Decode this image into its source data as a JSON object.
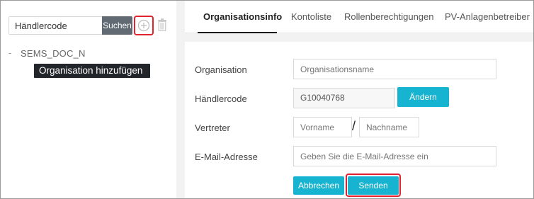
{
  "search": {
    "placeholder": "Händlercode",
    "button_label": "Suchen"
  },
  "icons": {
    "add": "plus-circle-icon",
    "delete": "trash-icon"
  },
  "tree": {
    "root_dash": "-",
    "root_label": "SEMS_DOC_N",
    "tooltip": "Organisation hinzufügen"
  },
  "tabs": [
    {
      "label": "Organisationsinfo",
      "active": true
    },
    {
      "label": "Kontoliste",
      "active": false
    },
    {
      "label": "Rollenberechtigungen",
      "active": false
    },
    {
      "label": "PV-Anlagenbetreiber",
      "active": false
    }
  ],
  "form": {
    "organisation": {
      "label": "Organisation",
      "placeholder": "Organisationsname",
      "value": ""
    },
    "dealer_code": {
      "label": "Händlercode",
      "value": "G10040768",
      "change_button": "Ändern"
    },
    "representative": {
      "label": "Vertreter",
      "first_placeholder": "Vorname",
      "separator": "/",
      "last_placeholder": "Nachname"
    },
    "email": {
      "label": "E-Mail-Adresse",
      "placeholder": "Geben Sie die E-Mail-Adresse ein"
    },
    "cancel_button": "Abbrechen",
    "send_button": "Senden"
  },
  "colors": {
    "accent": "#17b4d1",
    "highlight": "#e0232e",
    "search_button": "#616a72",
    "tooltip_bg": "#22262b"
  }
}
